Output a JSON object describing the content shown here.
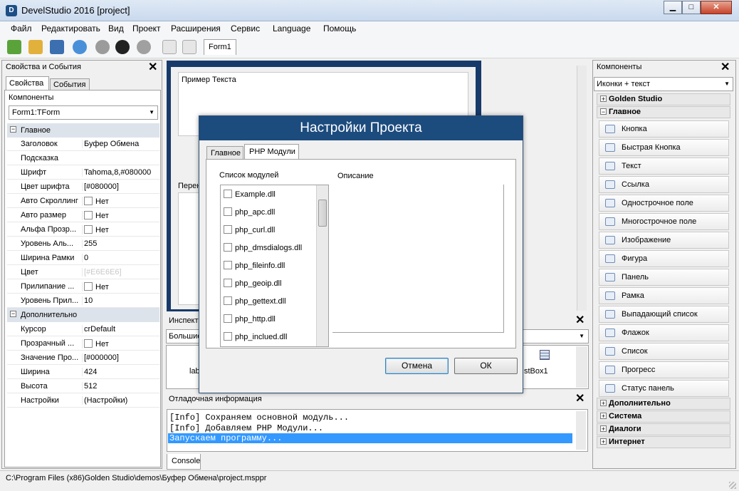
{
  "window": {
    "title": "DevelStudio 2016 [project]",
    "minimize": "▁",
    "maximize": "□",
    "close": "✕",
    "app_icon": "D"
  },
  "menu": [
    "Файл",
    "Редактировать",
    "Вид",
    "Проект",
    "Расширения",
    "Сервис",
    "Language",
    "Помощь"
  ],
  "toolbar": {
    "form_tab": "Form1"
  },
  "properties_panel": {
    "title": "Свойства и События",
    "tabs": [
      "Свойства",
      "События"
    ],
    "components_label": "Компоненты",
    "component_select": "Form1:TForm",
    "group_main": "Главное",
    "rows_main": [
      {
        "name": "Заголовок",
        "value": "Буфер Обмена"
      },
      {
        "name": "Подсказка",
        "value": ""
      },
      {
        "name": "Шрифт",
        "value": "Tahoma,8,#080000"
      },
      {
        "name": "Цвет шрифта",
        "value": "[#080000]"
      },
      {
        "name": "Авто Скроллинг",
        "value": "Нет"
      },
      {
        "name": "Авто размер",
        "value": "Нет"
      },
      {
        "name": "Альфа Прозр...",
        "value": "Нет"
      },
      {
        "name": "Уровень Аль...",
        "value": "255"
      },
      {
        "name": "Ширина Рамки",
        "value": "0"
      },
      {
        "name": "Цвет",
        "value": "[#E6E6E6]"
      },
      {
        "name": "Прилипание ...",
        "value": "Нет"
      },
      {
        "name": "Уровень Прил...",
        "value": "10"
      }
    ],
    "group_extra": "Дополнительно",
    "rows_extra": [
      {
        "name": "Курсор",
        "value": "crDefault"
      },
      {
        "name": "Прозрачный ...",
        "value": "Нет"
      },
      {
        "name": "Значение Про...",
        "value": "[#000000]"
      },
      {
        "name": "Ширина",
        "value": "424"
      },
      {
        "name": "Высота",
        "value": "512"
      },
      {
        "name": "Настройки",
        "value": "(Настройки)"
      }
    ]
  },
  "designer": {
    "label_text": "Пример Текста",
    "label_prefix": "Перен"
  },
  "inspector": {
    "title": "Инспект",
    "select": "Большие",
    "item_left": "lab",
    "item_right": "stBox1"
  },
  "debug": {
    "title": "Отладочная информация",
    "lines": [
      "[Info] Сохраняем основной модуль...",
      "[Info] Добавляем PHP Модули...",
      "Запускаем программу..."
    ],
    "tab": "Console"
  },
  "components_panel": {
    "title": "Компоненты",
    "select": "Иконки + текст",
    "groups_top": [
      "Golden Studio",
      "Главное"
    ],
    "items": [
      "Кнопка",
      "Быстрая Кнопка",
      "Текст",
      "Ссылка",
      "Однострочное поле",
      "Многострочное поле",
      "Изображение",
      "Фигура",
      "Панель",
      "Рамка",
      "Выпадающий список",
      "Флажок",
      "Список",
      "Прогресс",
      "Статус панель"
    ],
    "groups_bottom": [
      "Дополнительно",
      "Система",
      "Диалоги",
      "Интернет"
    ]
  },
  "dialog": {
    "title": "Настройки Проекта",
    "tabs": [
      "Главное",
      "PHP Модули"
    ],
    "modules_label": "Список модулей",
    "description_label": "Описание",
    "modules": [
      "Example.dll",
      "php_apc.dll",
      "php_curl.dll",
      "php_dmsdialogs.dll",
      "php_fileinfo.dll",
      "php_geoip.dll",
      "php_gettext.dll",
      "php_http.dll",
      "php_inclued.dll"
    ],
    "cancel": "Отмена",
    "ok": "ОК"
  },
  "statusbar": {
    "path": "C:\\Program Files (x86)Golden Studio\\demos\\Буфер Обмена\\project.msppr"
  },
  "colors": {
    "title_blue": "#1c4b7e",
    "selection": "#3399ff",
    "designer_frame": "#173a6a"
  }
}
